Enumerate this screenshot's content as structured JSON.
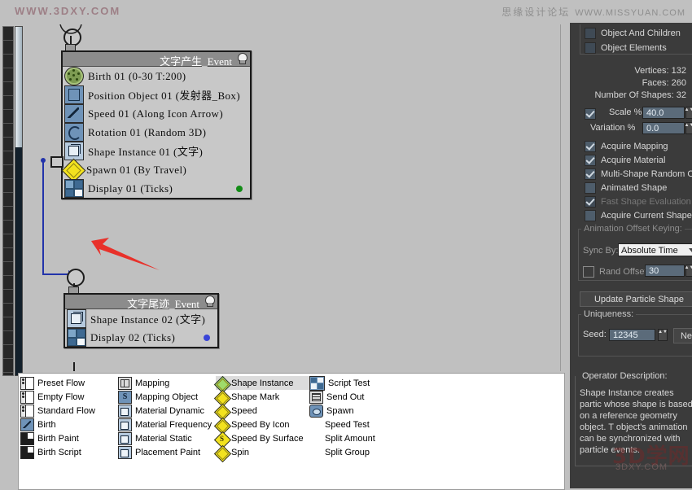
{
  "banner": {
    "left_text": "WWW.3DXY.COM",
    "right_cn": "思缘设计论坛",
    "right_en": "WWW.MISSYUAN.COM"
  },
  "canvas": {
    "events": [
      {
        "title": "文字产生_Event",
        "operators": [
          {
            "icon": "birth-icon",
            "label": "Birth 01  (0-30 T:200)"
          },
          {
            "icon": "position-object-icon",
            "label": "Position Object 01  (发射器_Box)"
          },
          {
            "icon": "speed-icon",
            "label": "Speed 01  (Along Icon Arrow)"
          },
          {
            "icon": "rotation-icon",
            "label": "Rotation 01  (Random 3D)"
          },
          {
            "icon": "shape-instance-icon",
            "label": "Shape Instance 01  (文字)"
          },
          {
            "icon": "spawn-icon",
            "label": "Spawn 01  (By Travel)"
          },
          {
            "icon": "display-icon",
            "label": "Display 01  (Ticks)",
            "dot": "#128c16"
          }
        ]
      },
      {
        "title": "文字尾迹_Event",
        "operators": [
          {
            "icon": "shape-instance-icon",
            "label": "Shape Instance 02  (文字)"
          },
          {
            "icon": "display-icon",
            "label": "Display 02  (Ticks)",
            "dot": "#3a45d8"
          }
        ]
      }
    ],
    "wire_color": "#2233aa",
    "annotation_arrow_color": "#e8312a"
  },
  "depot": {
    "columns": [
      {
        "items": [
          {
            "icon": "preset-flow-icon",
            "label": "Preset Flow"
          },
          {
            "icon": "empty-flow-icon",
            "label": "Empty Flow"
          },
          {
            "icon": "standard-flow-icon",
            "label": "Standard Flow"
          },
          {
            "icon": "birth-icon",
            "label": "Birth"
          },
          {
            "icon": "birth-paint-icon",
            "label": "Birth Paint"
          },
          {
            "icon": "birth-script-icon",
            "label": "Birth Script"
          }
        ]
      },
      {
        "items": [
          {
            "icon": "mapping-icon",
            "label": "Mapping"
          },
          {
            "icon": "mapping-object-icon",
            "label": "Mapping Object"
          },
          {
            "icon": "material-dynamic-icon",
            "label": "Material Dynamic"
          },
          {
            "icon": "material-frequency-icon",
            "label": "Material Frequency"
          },
          {
            "icon": "material-static-icon",
            "label": "Material Static"
          },
          {
            "icon": "placement-paint-icon",
            "label": "Placement Paint"
          }
        ]
      },
      {
        "items": [
          {
            "icon": "shape-instance-icon",
            "label": "Shape Instance",
            "selected": true
          },
          {
            "icon": "shape-mark-icon",
            "label": "Shape Mark"
          },
          {
            "icon": "speed-icon",
            "label": "Speed"
          },
          {
            "icon": "speed-by-icon-icon",
            "label": "Speed By Icon"
          },
          {
            "icon": "speed-by-surface-icon",
            "label": "Speed By Surface"
          },
          {
            "icon": "spin-icon",
            "label": "Spin"
          }
        ]
      },
      {
        "items": [
          {
            "icon": "script-test-icon",
            "label": "Script Test"
          },
          {
            "icon": "send-out-icon",
            "label": "Send Out"
          },
          {
            "icon": "spawn-icon",
            "label": "Spawn"
          },
          {
            "icon": "none",
            "label": "Speed Test"
          },
          {
            "icon": "none",
            "label": "Split Amount"
          },
          {
            "icon": "none",
            "label": "Split Group"
          }
        ]
      }
    ]
  },
  "panel": {
    "top_checks": [
      {
        "label": "Object And Children",
        "checked": false
      },
      {
        "label": "Object Elements",
        "checked": false
      }
    ],
    "stats": [
      "Vertices:  132",
      "Faces:  260",
      "Number Of Shapes: 32"
    ],
    "scale": {
      "check_label": "",
      "checked": true,
      "label": "Scale %",
      "value": "40.0"
    },
    "variation": {
      "label": "Variation %",
      "value": "0.0"
    },
    "options": [
      {
        "label": "Acquire Mapping",
        "checked": true,
        "disabled": false
      },
      {
        "label": "Acquire Material",
        "checked": true,
        "disabled": false
      },
      {
        "label": "Multi-Shape Random Ord",
        "checked": true,
        "disabled": false
      },
      {
        "label": "Animated Shape",
        "checked": false,
        "disabled": false
      },
      {
        "label": "Fast Shape Evaluation",
        "checked": true,
        "disabled": true
      },
      {
        "label": "Acquire Current Shape",
        "checked": false,
        "disabled": false
      }
    ],
    "anim_group_label": "Animation Offset Keying:",
    "sync_by_label": "Sync By:",
    "sync_by_value": "Absolute Time",
    "rand_offset": {
      "label": "Rand Offset",
      "checked": false,
      "value": "30"
    },
    "update_button": "Update Particle Shape",
    "uniqueness_label": "Uniqueness:",
    "seed_label": "Seed:",
    "seed_value": "12345",
    "new_button": "New",
    "description_title": "Operator Description:",
    "description_text": "Shape Instance creates partic whose shape is based on a reference geometry object. T object's animation can be synchronized with particle events."
  },
  "watermark": {
    "main": "3D学网",
    "sub": "3DXY.COM"
  }
}
